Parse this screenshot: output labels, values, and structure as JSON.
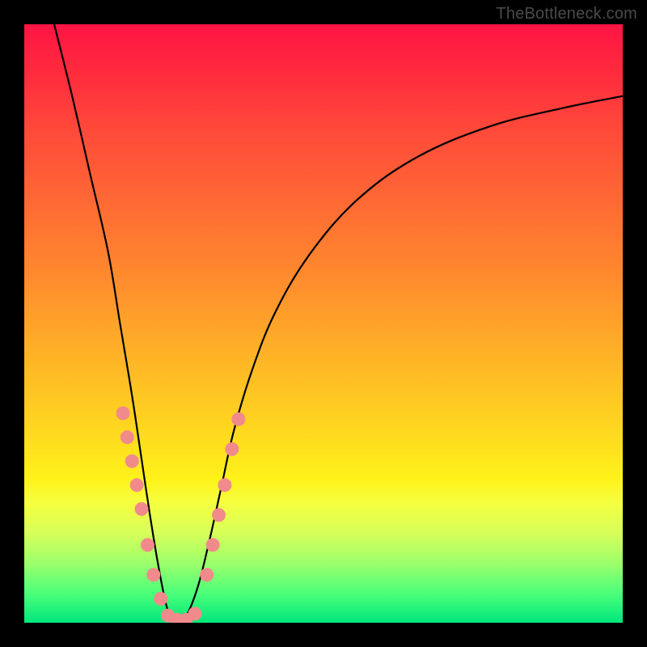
{
  "watermark": "TheBottleneck.com",
  "chart_data": {
    "type": "line",
    "title": "",
    "xlabel": "",
    "ylabel": "",
    "xlim": [
      0,
      100
    ],
    "ylim": [
      0,
      100
    ],
    "series": [
      {
        "name": "bottleneck-curve",
        "x": [
          5,
          8,
          11,
          14,
          16,
          18,
          19.5,
          21,
          22.5,
          24,
          25.5,
          27,
          29,
          31,
          33,
          35,
          38,
          42,
          48,
          56,
          66,
          78,
          90,
          100
        ],
        "y": [
          100,
          88,
          75,
          62,
          50,
          38,
          28,
          18,
          9,
          2,
          0,
          1,
          6,
          14,
          23,
          32,
          42,
          52,
          62,
          71,
          78,
          83,
          86,
          88
        ]
      }
    ],
    "markers": [
      {
        "name": "dot-cluster",
        "color": "#f18a8a",
        "points": [
          {
            "x": 16.5,
            "y": 35
          },
          {
            "x": 17.2,
            "y": 31
          },
          {
            "x": 18.0,
            "y": 27
          },
          {
            "x": 18.8,
            "y": 23
          },
          {
            "x": 19.6,
            "y": 19
          },
          {
            "x": 20.6,
            "y": 13
          },
          {
            "x": 21.6,
            "y": 8
          },
          {
            "x": 22.8,
            "y": 4
          },
          {
            "x": 24.0,
            "y": 1.2
          },
          {
            "x": 25.5,
            "y": 0.5
          },
          {
            "x": 27.0,
            "y": 0.5
          },
          {
            "x": 28.5,
            "y": 1.5
          },
          {
            "x": 30.5,
            "y": 8
          },
          {
            "x": 31.5,
            "y": 13
          },
          {
            "x": 32.5,
            "y": 18
          },
          {
            "x": 33.5,
            "y": 23
          },
          {
            "x": 34.7,
            "y": 29
          },
          {
            "x": 35.8,
            "y": 34
          }
        ]
      }
    ]
  }
}
